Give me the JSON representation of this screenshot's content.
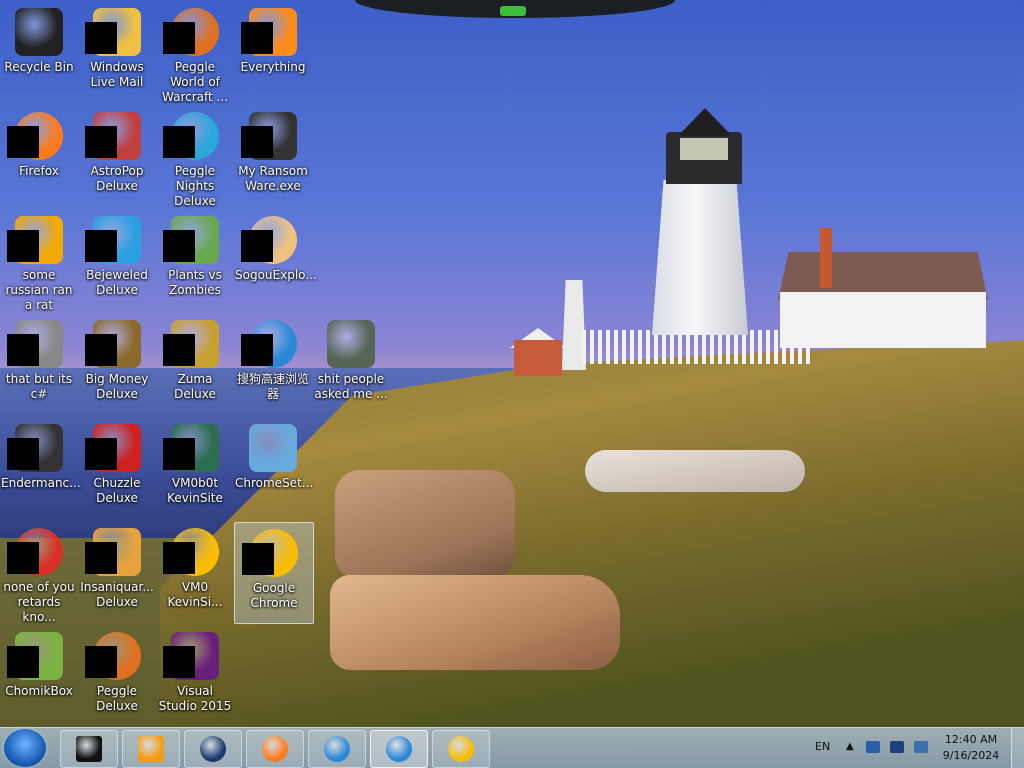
{
  "desktop": {
    "icons": [
      {
        "label": "Recycle Bin",
        "icon": "recycle-bin-icon",
        "color": "#222222"
      },
      {
        "label": "Windows Live Mail",
        "icon": "mail-icon",
        "color": "#f0c040"
      },
      {
        "label": "Peggle World of Warcraft ...",
        "icon": "peggle-icon",
        "color": "#e07020"
      },
      {
        "label": "Everything",
        "icon": "search-icon",
        "color": "#ff8c1a"
      },
      {
        "label": "Firefox",
        "icon": "firefox-icon",
        "color": "#ff7b1c"
      },
      {
        "label": "AstroPop Deluxe",
        "icon": "game-icon",
        "color": "#c04040"
      },
      {
        "label": "Peggle Nights Deluxe",
        "icon": "peggle-icon",
        "color": "#2ba7d9"
      },
      {
        "label": "My Ransom Ware.exe",
        "icon": "terminal-icon",
        "color": "#333333"
      },
      {
        "label": "some russian ran a rat",
        "icon": "app-icon",
        "color": "#f2a900"
      },
      {
        "label": "Bejeweled Deluxe",
        "icon": "gem-icon",
        "color": "#2aa0e0"
      },
      {
        "label": "Plants vs Zombies",
        "icon": "plant-icon",
        "color": "#6aa84f"
      },
      {
        "label": "SogouExplo...",
        "icon": "sogou-icon",
        "color": "#f1c27d"
      },
      {
        "label": "that but its c#",
        "icon": "stack-icon",
        "color": "#888888"
      },
      {
        "label": "Big Money Deluxe",
        "icon": "money-icon",
        "color": "#8a6a2a"
      },
      {
        "label": "Zuma Deluxe",
        "icon": "zuma-icon",
        "color": "#c8a030"
      },
      {
        "label": "搜狗高速浏览器",
        "icon": "sogou-browser-icon",
        "color": "#2b88d8"
      },
      {
        "label": "shit people asked me ...",
        "icon": "folder-icon",
        "color": "#556655"
      },
      {
        "label": "Endermanc...",
        "icon": "terminal-icon",
        "color": "#333333"
      },
      {
        "label": "Chuzzle Deluxe",
        "icon": "chuzzle-icon",
        "color": "#d02020"
      },
      {
        "label": "VM0b0t KevinSite",
        "icon": "vm-icon",
        "color": "#2b6e50"
      },
      {
        "label": "ChromeSet...",
        "icon": "installer-icon",
        "color": "#66aadd"
      },
      {
        "label": "none of you retards kno...",
        "icon": "chrome-icon",
        "color": "#d93025"
      },
      {
        "label": "Insaniquar... Deluxe",
        "icon": "game-icon",
        "color": "#e6a23c"
      },
      {
        "label": "VM0 KevinSi...",
        "icon": "chrome-icon",
        "color": "#fbbc05"
      },
      {
        "label": "Google Chrome",
        "icon": "chrome-icon",
        "color": "#fbbc05"
      },
      {
        "label": "ChomikBox",
        "icon": "chomikbox-icon",
        "color": "#7cb342"
      },
      {
        "label": "Peggle Deluxe",
        "icon": "peggle-icon",
        "color": "#e07020"
      },
      {
        "label": "Visual Studio 2015",
        "icon": "visual-studio-icon",
        "color": "#68217a"
      }
    ]
  },
  "taskbar": {
    "buttons": [
      {
        "name": "taskbar-app-1",
        "icon": "window-icon",
        "color": "#111111"
      },
      {
        "name": "taskbar-media",
        "icon": "media-player-icon",
        "color": "#f39c12"
      },
      {
        "name": "taskbar-globe",
        "icon": "globe-icon",
        "color": "#1b3b6f"
      },
      {
        "name": "taskbar-firefox",
        "icon": "firefox-icon",
        "color": "#ff7b1c"
      },
      {
        "name": "taskbar-sogou",
        "icon": "sogou-browser-icon",
        "color": "#2b88d8"
      },
      {
        "name": "taskbar-sogou-2",
        "icon": "sogou-browser-icon",
        "color": "#2b88d8"
      },
      {
        "name": "taskbar-chrome",
        "icon": "chrome-icon",
        "color": "#fbbc05"
      }
    ],
    "language": "EN",
    "time": "12:40 AM",
    "date": "9/16/2024"
  }
}
